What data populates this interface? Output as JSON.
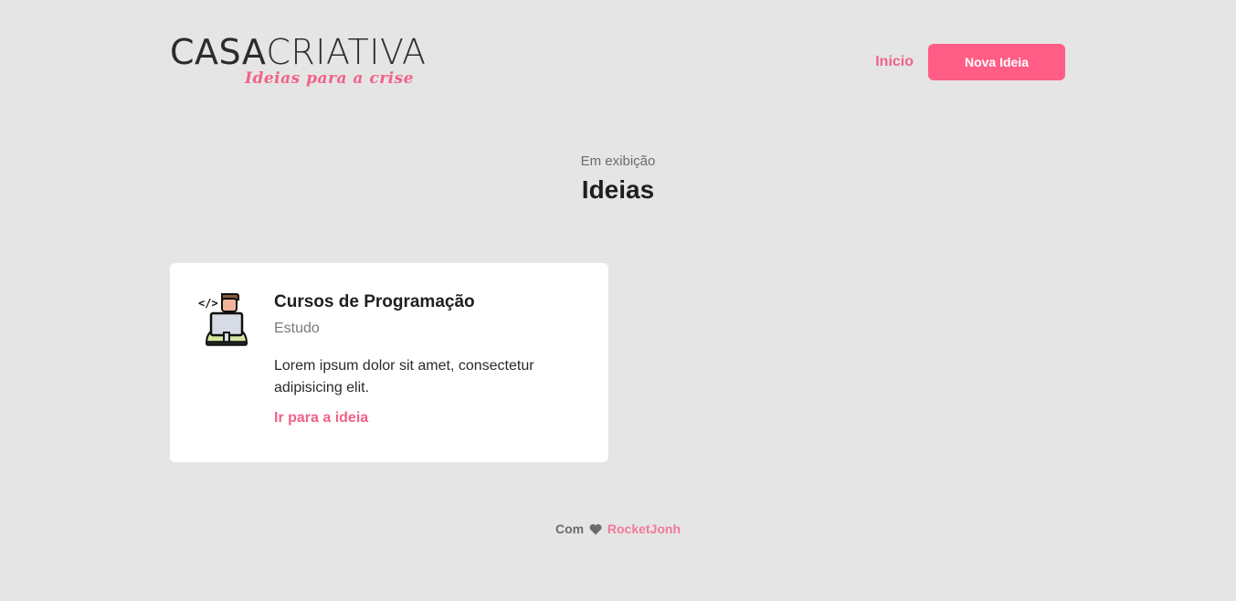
{
  "header": {
    "logo": {
      "part1": "CASA",
      "part2": "CRIATIVA",
      "tagline": "Ideias para a crise"
    },
    "nav": {
      "home_label": "Inicio",
      "new_idea_label": "Nova Ideia"
    }
  },
  "section": {
    "subtitle": "Em exibição",
    "title": "Ideias"
  },
  "ideas": [
    {
      "icon": "programmer-laptop-icon",
      "title": "Cursos de Programação",
      "category": "Estudo",
      "description": "Lorem ipsum dolor sit amet, consectetur adipisicing elit.",
      "link_label": "Ir para a ideia"
    }
  ],
  "footer": {
    "prefix": "Com",
    "icon": "heart-icon",
    "author": "RocketJonh"
  },
  "colors": {
    "background": "#e5e5e5",
    "accent": "#ff5d85",
    "accent_text": "#f06287",
    "card": "#ffffff"
  }
}
